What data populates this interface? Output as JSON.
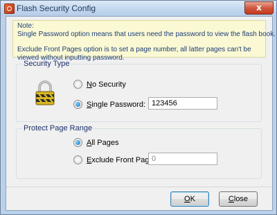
{
  "window": {
    "title": "Flash Security Config",
    "close_glyph": "x"
  },
  "note": {
    "lines": [
      "Note:",
      "Single Password option means that users need the password to view the flash book.",
      "",
      "Exclude Front Pages option is to set a page number, all latter pages can't be",
      "viewed without inputting password."
    ]
  },
  "security": {
    "group_title": "Security Type",
    "icon": "padlock-icon",
    "no_security": {
      "label_accel": "N",
      "label_rest": "o Security",
      "checked": false
    },
    "single_password": {
      "label_accel": "S",
      "label_rest": "ingle Password:",
      "checked": true,
      "value": "123456"
    }
  },
  "protect": {
    "group_title": "Protect Page Range",
    "all_pages": {
      "label_accel": "A",
      "label_rest": "ll Pages",
      "checked": true
    },
    "exclude_front": {
      "label_accel": "E",
      "label_rest": "xclude Front Pages",
      "checked": false,
      "value": "0"
    }
  },
  "buttons": {
    "ok": {
      "accel": "O",
      "rest": "K"
    },
    "close": {
      "accel": "C",
      "rest": "lose"
    }
  },
  "colors": {
    "note_bg": "#fbf9d3",
    "note_text": "#1c3c78",
    "group_title": "#1c2f6b"
  }
}
